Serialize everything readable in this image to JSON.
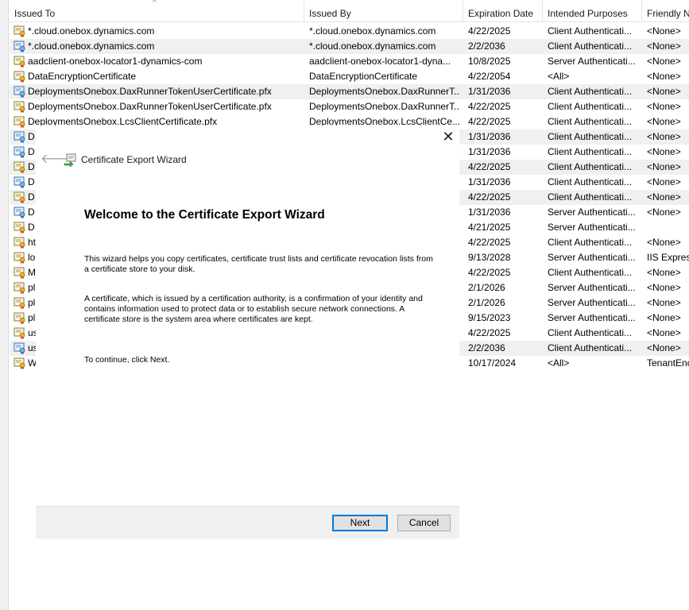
{
  "columns": {
    "issued_to": "Issued To",
    "issued_by": "Issued By",
    "expiration_date": "Expiration Date",
    "intended_purposes": "Intended Purposes",
    "friendly_name": "Friendly N"
  },
  "sort_indicator": "^",
  "rows": [
    {
      "icon": "certificate-icon",
      "issued_to": "*.cloud.onebox.dynamics.com",
      "issued_by": "*.cloud.onebox.dynamics.com",
      "expiration": "4/22/2025",
      "purposes": "Client Authenticati...",
      "friendly": "<None>"
    },
    {
      "icon": "certificate-chain-icon",
      "issued_to": "*.cloud.onebox.dynamics.com",
      "issued_by": "*.cloud.onebox.dynamics.com",
      "expiration": "2/2/2036",
      "purposes": "Client Authenticati...",
      "friendly": "<None>"
    },
    {
      "icon": "certificate-icon",
      "issued_to": "aadclient-onebox-locator1-dynamics-com",
      "issued_by": "aadclient-onebox-locator1-dyna...",
      "expiration": "10/8/2025",
      "purposes": "Server Authenticati...",
      "friendly": "<None>"
    },
    {
      "icon": "certificate-icon",
      "issued_to": "DataEncryptionCertificate",
      "issued_by": "DataEncryptionCertificate",
      "expiration": "4/22/2054",
      "purposes": "<All>",
      "friendly": "<None>"
    },
    {
      "icon": "certificate-chain-icon",
      "issued_to": "DeploymentsOnebox.DaxRunnerTokenUserCertificate.pfx",
      "issued_by": "DeploymentsOnebox.DaxRunnerT...",
      "expiration": "1/31/2036",
      "purposes": "Client Authenticati...",
      "friendly": "<None>"
    },
    {
      "icon": "certificate-icon",
      "issued_to": "DeploymentsOnebox.DaxRunnerTokenUserCertificate.pfx",
      "issued_by": "DeploymentsOnebox.DaxRunnerT...",
      "expiration": "4/22/2025",
      "purposes": "Client Authenticati...",
      "friendly": "<None>"
    },
    {
      "icon": "certificate-icon",
      "issued_to": "DeploymentsOnebox.LcsClientCertificate.pfx",
      "issued_by": "DeploymentsOnebox.LcsClientCe...",
      "expiration": "4/22/2025",
      "purposes": "Client Authenticati...",
      "friendly": "<None>"
    },
    {
      "icon": "certificate-chain-icon",
      "issued_to": "D",
      "issued_by": "",
      "expiration": "1/31/2036",
      "purposes": "Client Authenticati...",
      "friendly": "<None>"
    },
    {
      "icon": "certificate-chain-icon",
      "issued_to": "D",
      "issued_by": "",
      "expiration": "1/31/2036",
      "purposes": "Client Authenticati...",
      "friendly": "<None>"
    },
    {
      "icon": "certificate-icon",
      "issued_to": "D",
      "issued_by": "",
      "expiration": "4/22/2025",
      "purposes": "Client Authenticati...",
      "friendly": "<None>"
    },
    {
      "icon": "certificate-chain-icon",
      "issued_to": "D",
      "issued_by": "",
      "expiration": "1/31/2036",
      "purposes": "Client Authenticati...",
      "friendly": "<None>"
    },
    {
      "icon": "certificate-icon",
      "issued_to": "D",
      "issued_by": "",
      "expiration": "4/22/2025",
      "purposes": "Client Authenticati...",
      "friendly": "<None>"
    },
    {
      "icon": "certificate-chain-icon",
      "issued_to": "D",
      "issued_by": "",
      "expiration": "1/31/2036",
      "purposes": "Server Authenticati...",
      "friendly": "<None>"
    },
    {
      "icon": "certificate-icon",
      "issued_to": "D",
      "issued_by": "",
      "expiration": "4/21/2025",
      "purposes": "Server Authenticati...",
      "friendly": ""
    },
    {
      "icon": "certificate-icon",
      "issued_to": "ht",
      "issued_by": "",
      "expiration": "4/22/2025",
      "purposes": "Client Authenticati...",
      "friendly": "<None>"
    },
    {
      "icon": "certificate-icon",
      "issued_to": "lo",
      "issued_by": "",
      "expiration": "9/13/2028",
      "purposes": "Server Authenticati...",
      "friendly": "IIS Express"
    },
    {
      "icon": "certificate-icon",
      "issued_to": "M",
      "issued_by": "",
      "expiration": "4/22/2025",
      "purposes": "Client Authenticati...",
      "friendly": "<None>"
    },
    {
      "icon": "certificate-icon",
      "issued_to": "pl",
      "issued_by": "",
      "expiration": "2/1/2026",
      "purposes": "Server Authenticati...",
      "friendly": "<None>"
    },
    {
      "icon": "certificate-icon",
      "issued_to": "pl",
      "issued_by": "",
      "expiration": "2/1/2026",
      "purposes": "Server Authenticati...",
      "friendly": "<None>"
    },
    {
      "icon": "certificate-icon",
      "issued_to": "pl",
      "issued_by": "",
      "expiration": "9/15/2023",
      "purposes": "Server Authenticati...",
      "friendly": "<None>"
    },
    {
      "icon": "certificate-icon",
      "issued_to": "us",
      "issued_by": "",
      "expiration": "4/22/2025",
      "purposes": "Client Authenticati...",
      "friendly": "<None>"
    },
    {
      "icon": "certificate-chain-icon",
      "issued_to": "us",
      "issued_by": "",
      "expiration": "2/2/2036",
      "purposes": "Client Authenticati...",
      "friendly": "<None>"
    },
    {
      "icon": "certificate-icon",
      "issued_to": "W",
      "issued_by": "",
      "expiration": "10/17/2024",
      "purposes": "<All>",
      "friendly": "TenantEnc"
    }
  ],
  "dialog": {
    "close_glyph": "✕",
    "back_glyph": "🡐",
    "title": "Certificate Export Wizard",
    "heading": "Welcome to the Certificate Export Wizard",
    "paragraph1": "This wizard helps you copy certificates, certificate trust lists and certificate revocation lists from a certificate store to your disk.",
    "paragraph2": "A certificate, which is issued by a certification authority, is a confirmation of your identity and contains information used to protect data or to establish secure network connections. A certificate store is the system area where certificates are kept.",
    "paragraph3": "To continue, click Next.",
    "next_label": "Next",
    "cancel_label": "Cancel"
  },
  "colors": {
    "selection_row": "#f0f0f0",
    "default_button_border": "#0078d7",
    "dialog_footer": "#f0f0f0"
  }
}
